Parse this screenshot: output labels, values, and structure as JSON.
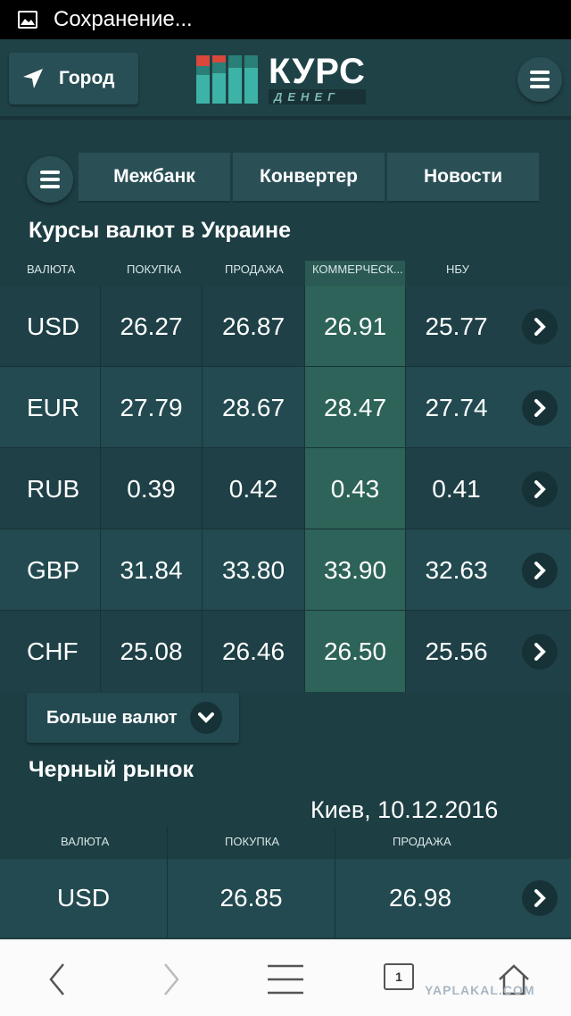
{
  "status_bar": {
    "text": "Сохранение..."
  },
  "header": {
    "city_label": "Город",
    "logo_main": "КУРС",
    "logo_sub": "ДЕНЕГ"
  },
  "nav": {
    "tabs": [
      {
        "label": "Межбанк"
      },
      {
        "label": "Конвертер"
      },
      {
        "label": "Новости"
      }
    ]
  },
  "rates": {
    "title": "Курсы валют в Украине",
    "columns": [
      "ВАЛЮТА",
      "ПОКУПКА",
      "ПРОДАЖА",
      "КОММЕРЧЕСК...",
      "НБУ"
    ],
    "rows": [
      {
        "currency": "USD",
        "buy": "26.27",
        "sell": "26.87",
        "commercial": "26.91",
        "nbu": "25.77"
      },
      {
        "currency": "EUR",
        "buy": "27.79",
        "sell": "28.67",
        "commercial": "28.47",
        "nbu": "27.74"
      },
      {
        "currency": "RUB",
        "buy": "0.39",
        "sell": "0.42",
        "commercial": "0.43",
        "nbu": "0.41"
      },
      {
        "currency": "GBP",
        "buy": "31.84",
        "sell": "33.80",
        "commercial": "33.90",
        "nbu": "32.63"
      },
      {
        "currency": "CHF",
        "buy": "25.08",
        "sell": "26.46",
        "commercial": "26.50",
        "nbu": "25.56"
      }
    ],
    "more_label": "Больше валют"
  },
  "black_market": {
    "title": "Черный рынок",
    "location_date": "Киев, 10.12.2016",
    "columns": [
      "ВАЛЮТА",
      "ПОКУПКА",
      "ПРОДАЖА"
    ],
    "rows": [
      {
        "currency": "USD",
        "buy": "26.85",
        "sell": "26.98"
      }
    ]
  },
  "browser_bar": {
    "tab_count": "1",
    "watermark": "YAPLAKAL.COM"
  },
  "colors": {
    "background": "#1d3e43",
    "commercial_column": "#2d6358",
    "logo_red": "#d9483b",
    "logo_teal": "#3db3a8"
  }
}
